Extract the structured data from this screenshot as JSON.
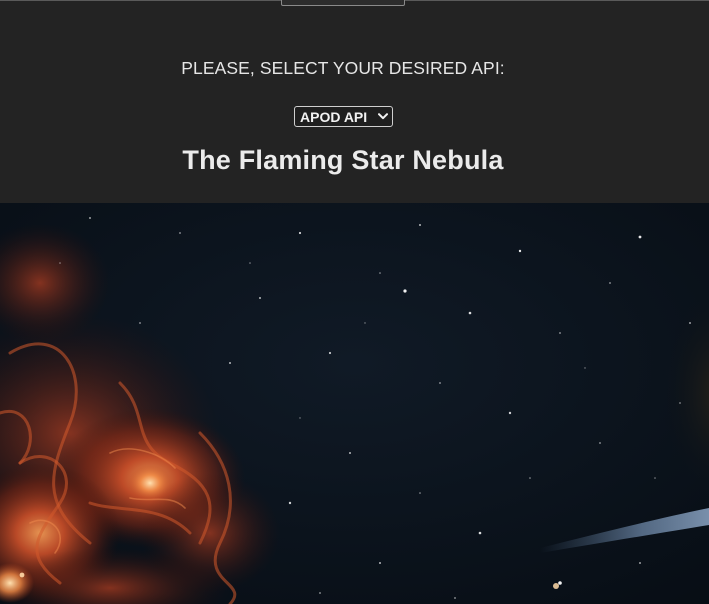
{
  "prompt": "PLEASE, SELECT YOUR DESIRED API:",
  "api_select": {
    "selected": "APOD API"
  },
  "apod": {
    "title": "The Flaming Star Nebula"
  },
  "colors": {
    "background": "#232323",
    "text": "#ebebeb",
    "space": "#0a1119",
    "nebula": "#c0451f"
  },
  "icons": {
    "select_chevron": "chevron-down-icon"
  }
}
